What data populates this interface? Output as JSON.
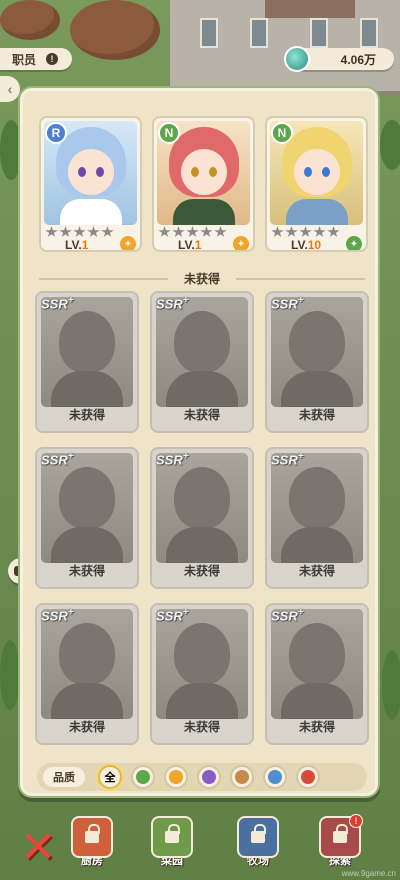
{
  "topbar": {
    "job_label": "职员",
    "job_alert": "!",
    "currency_amount": "4.06万",
    "side_tab_glyph": "‹"
  },
  "owned": [
    {
      "rarity": "R",
      "rarity_color": "#4f7fd0",
      "level_prefix": "LV.",
      "level": "1",
      "stars_on": 0,
      "palette": "blue",
      "role_icon": "food-icon"
    },
    {
      "rarity": "N",
      "rarity_color": "#5ea64a",
      "level_prefix": "LV.",
      "level": "1",
      "stars_on": 0,
      "palette": "red",
      "role_icon": "hammer-icon"
    },
    {
      "rarity": "N",
      "rarity_color": "#5ea64a",
      "level_prefix": "LV.",
      "level": "10",
      "stars_on": 0,
      "palette": "gold",
      "role_icon": "leaf-icon"
    }
  ],
  "section_title": "未获得",
  "locked": [
    {
      "tier": "SSR",
      "tier_plus": "+",
      "label": "未获得"
    },
    {
      "tier": "SSR",
      "tier_plus": "+",
      "label": "未获得"
    },
    {
      "tier": "SSR",
      "tier_plus": "+",
      "label": "未获得"
    },
    {
      "tier": "SSR",
      "tier_plus": "+",
      "label": "未获得"
    },
    {
      "tier": "SSR",
      "tier_plus": "+",
      "label": "未获得"
    },
    {
      "tier": "SSR",
      "tier_plus": "+",
      "label": "未获得"
    },
    {
      "tier": "SSR",
      "tier_plus": "+",
      "label": "未获得"
    },
    {
      "tier": "SSR",
      "tier_plus": "+",
      "label": "未获得"
    },
    {
      "tier": "SSR",
      "tier_plus": "+",
      "label": "未获得"
    }
  ],
  "filter": {
    "label": "品质",
    "all_label": "全",
    "options": [
      {
        "icon": "leaf-filter-icon",
        "color": "#5ea64a"
      },
      {
        "icon": "flower-filter-icon",
        "color": "#f0a62a"
      },
      {
        "icon": "gem-filter-icon",
        "color": "#8a5ac8"
      },
      {
        "icon": "hammer-filter-icon",
        "color": "#c88a4a"
      },
      {
        "icon": "book-filter-icon",
        "color": "#4f8fd0"
      },
      {
        "icon": "heart-filter-icon",
        "color": "#d84a3a"
      }
    ]
  },
  "nav": {
    "close_glyph": "✕",
    "items": [
      {
        "label": "厨房",
        "color": "#d0603c"
      },
      {
        "label": "菜园",
        "color": "#6e9a4a"
      },
      {
        "label": "牧场",
        "color": "#4a6fa0"
      },
      {
        "label": "探索",
        "color": "#a84a4a",
        "badge": "!"
      }
    ]
  },
  "watermark": "www.9game.cn"
}
